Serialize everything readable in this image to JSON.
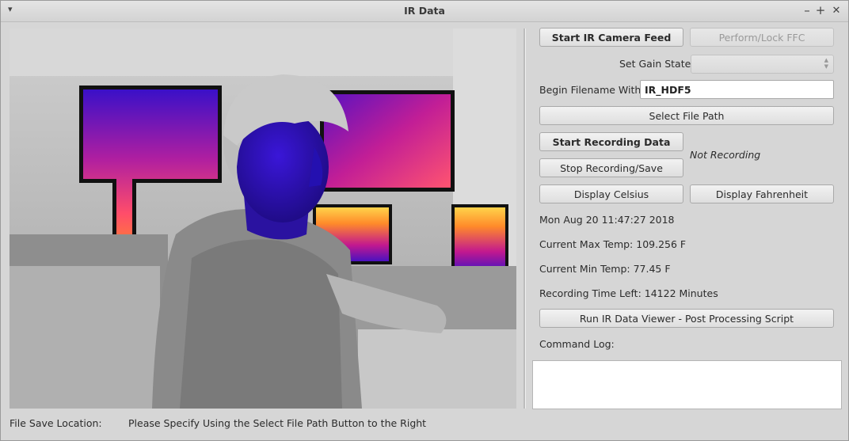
{
  "window": {
    "title": "IR Data",
    "controls": {
      "minimize": "–",
      "maximize": "+",
      "close": "✕"
    },
    "menu_glyph": "▾"
  },
  "camera": {
    "palette": "ironbow / grayscale"
  },
  "controls": {
    "start_feed_label": "Start IR Camera Feed",
    "ffc_label": "Perform/Lock FFC",
    "gain_label": "Set Gain State:",
    "gain_value": "",
    "filename_label": "Begin Filename With:",
    "filename_value": "IR_HDF5",
    "select_path_label": "Select File Path",
    "start_recording_label": "Start Recording Data",
    "stop_recording_label": "Stop Recording/Save",
    "recording_status": "Not Recording",
    "celsius_label": "Display Celsius",
    "fahrenheit_label": "Display Fahrenheit",
    "datetime": "Mon Aug 20 11:47:27 2018",
    "max_temp": "Current Max Temp: 109.256 F",
    "min_temp": "Current Min Temp: 77.45 F",
    "recording_time_left": "Recording Time Left: 14122 Minutes",
    "viewer_label": "Run IR Data Viewer - Post Processing Script",
    "command_log_label": "Command Log:"
  },
  "footer": {
    "save_location_label": "File Save Location:",
    "save_location_value": "Please Specify Using the Select File Path Button to the Right"
  },
  "colors": {
    "window_bg": "#d6d6d6",
    "thermal_hot": "#ffb000",
    "thermal_mid": "#d81b8c",
    "thermal_cold": "#3a10c8"
  }
}
